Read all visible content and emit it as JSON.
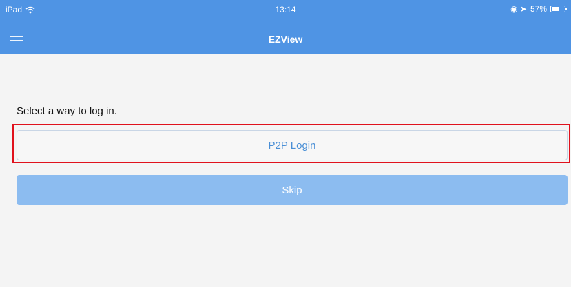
{
  "status_bar": {
    "device": "iPad",
    "wifi_icon": "wifi-icon",
    "time": "13:14",
    "indicators": "◉ ➤",
    "battery": "57%",
    "battery_level_percent": 57
  },
  "nav_bar": {
    "menu_icon": "hamburger-menu-icon",
    "title": "EZView",
    "color": "#4f94e4"
  },
  "login": {
    "prompt": "Select a way to log in.",
    "p2p_label": "P2P Login",
    "skip_label": "Skip",
    "highlight_color": "#e0111c"
  }
}
